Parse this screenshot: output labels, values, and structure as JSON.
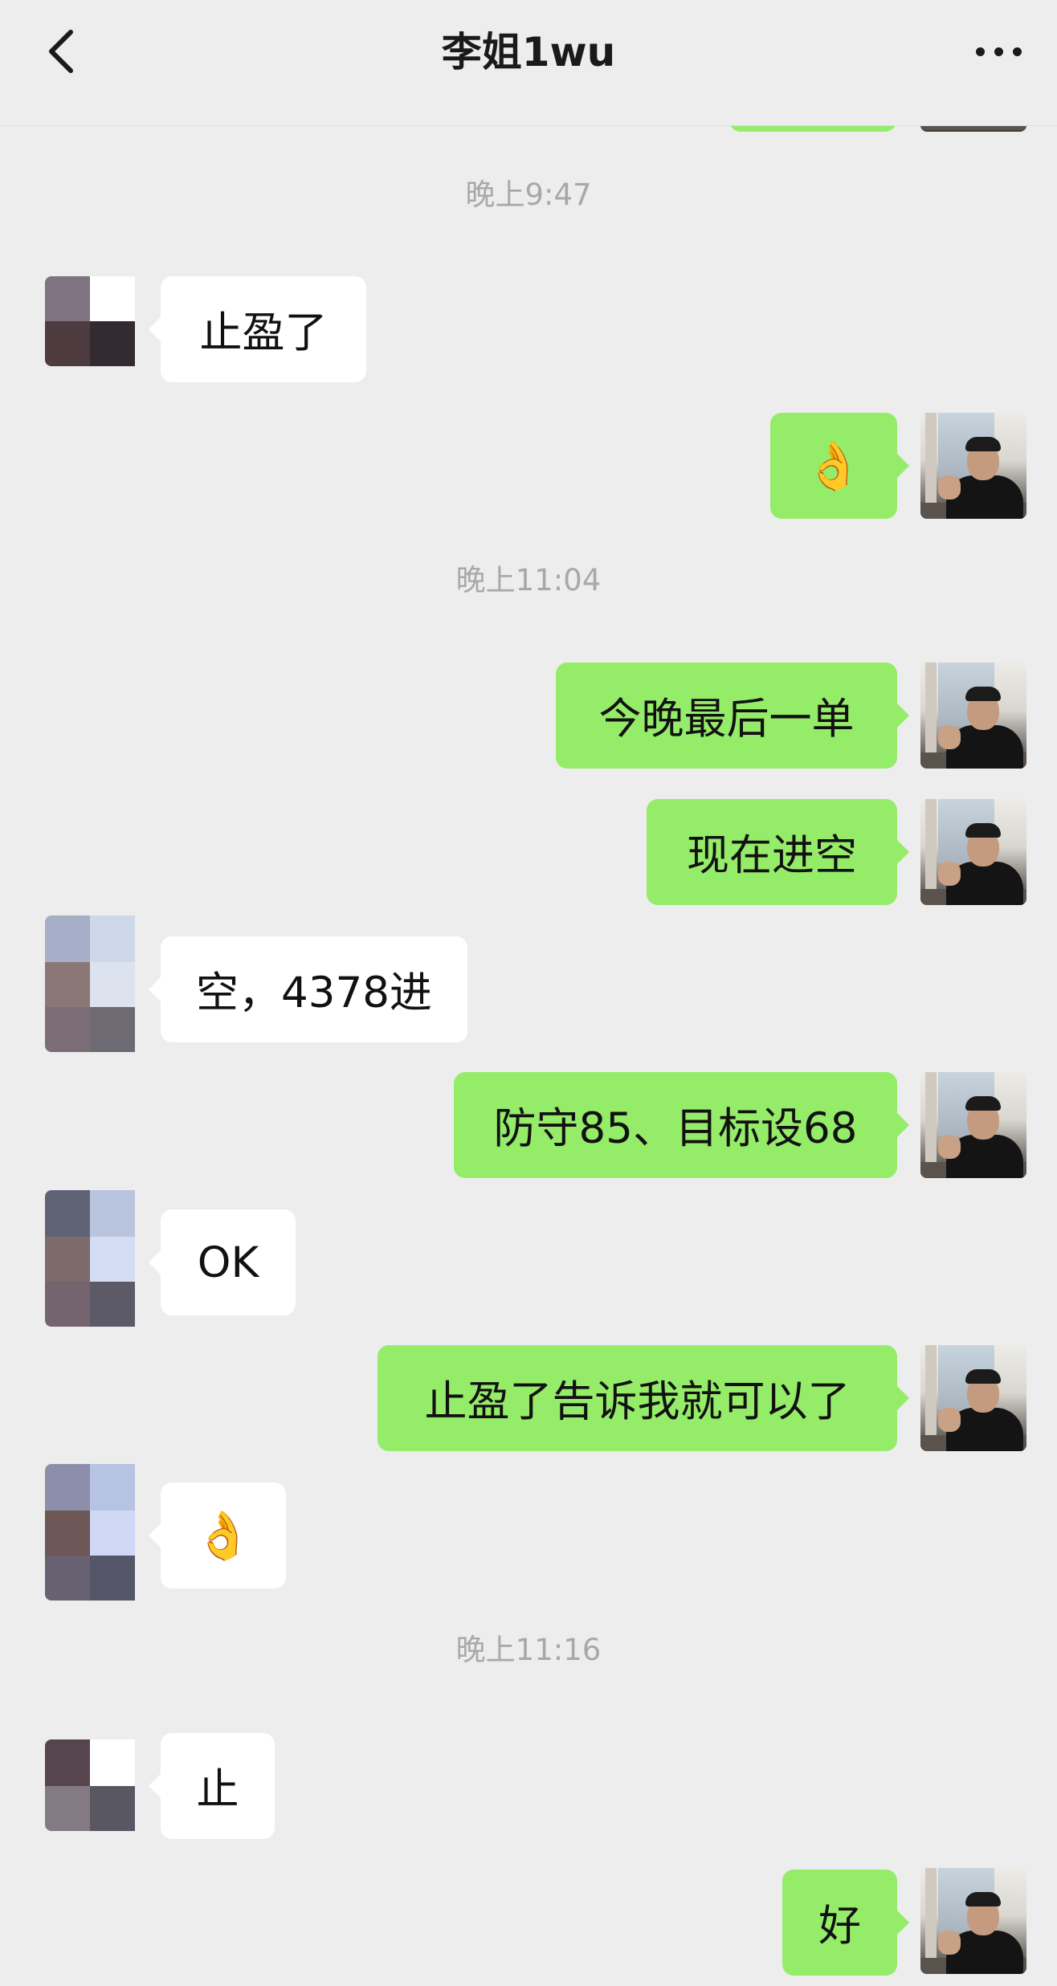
{
  "header": {
    "title": "李姐1wu",
    "back_icon": "chevron-left-icon",
    "more_icon": "more-dots-icon"
  },
  "colors": {
    "background": "#ededed",
    "self_bubble": "#95ec69",
    "other_bubble": "#ffffff",
    "timestamp_text": "#a8a8a8"
  },
  "timestamps": [
    "晚上9:47",
    "晚上11:04",
    "晚上11:16"
  ],
  "messages": [
    {
      "sender": "contact",
      "text": "止盈了"
    },
    {
      "sender": "self",
      "text": "👌"
    },
    {
      "sender": "self",
      "text": "今晚最后一单"
    },
    {
      "sender": "self",
      "text": "现在进空"
    },
    {
      "sender": "contact",
      "text": "空，4378进"
    },
    {
      "sender": "self",
      "text": "防守85、目标设68"
    },
    {
      "sender": "contact",
      "text": "OK"
    },
    {
      "sender": "self",
      "text": "止盈了告诉我就可以了"
    },
    {
      "sender": "contact",
      "text": "👌"
    },
    {
      "sender": "contact",
      "text": "止"
    },
    {
      "sender": "self",
      "text": "好"
    }
  ]
}
